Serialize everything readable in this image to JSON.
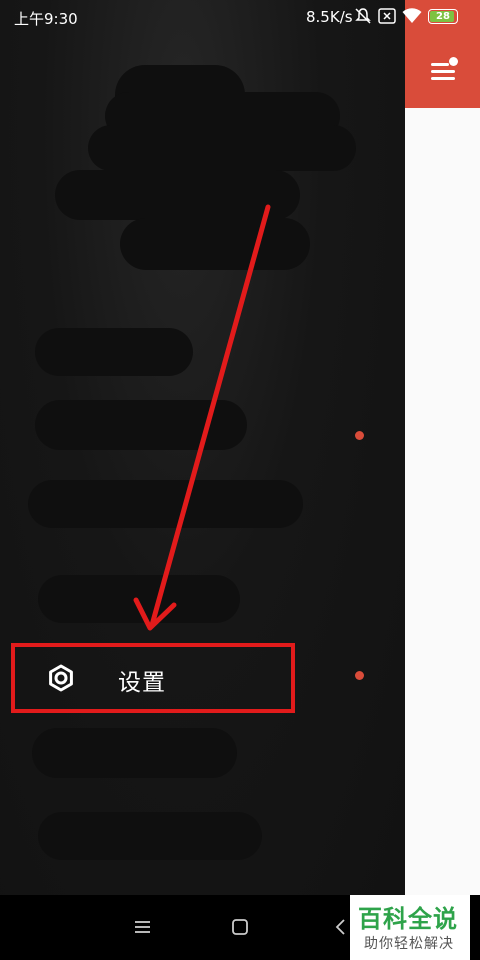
{
  "status_bar": {
    "time": "上午9:30",
    "network_speed": "8.5K/s",
    "battery_level": "28",
    "icons": [
      "mute-icon",
      "sim-x-icon",
      "wifi-icon",
      "battery-icon"
    ]
  },
  "app_header": {
    "menu_icon": "menu-icon",
    "accent_color": "#d94c3a"
  },
  "drawer": {
    "settings_label": "设置",
    "settings_icon": "gear-icon"
  },
  "annotation": {
    "color": "#e21b1b"
  },
  "nav_bar": {
    "buttons": [
      "menu-nav-icon",
      "home-icon",
      "back-icon"
    ]
  },
  "watermark": {
    "title": "百科全说",
    "subtitle": "助你轻松解决"
  }
}
